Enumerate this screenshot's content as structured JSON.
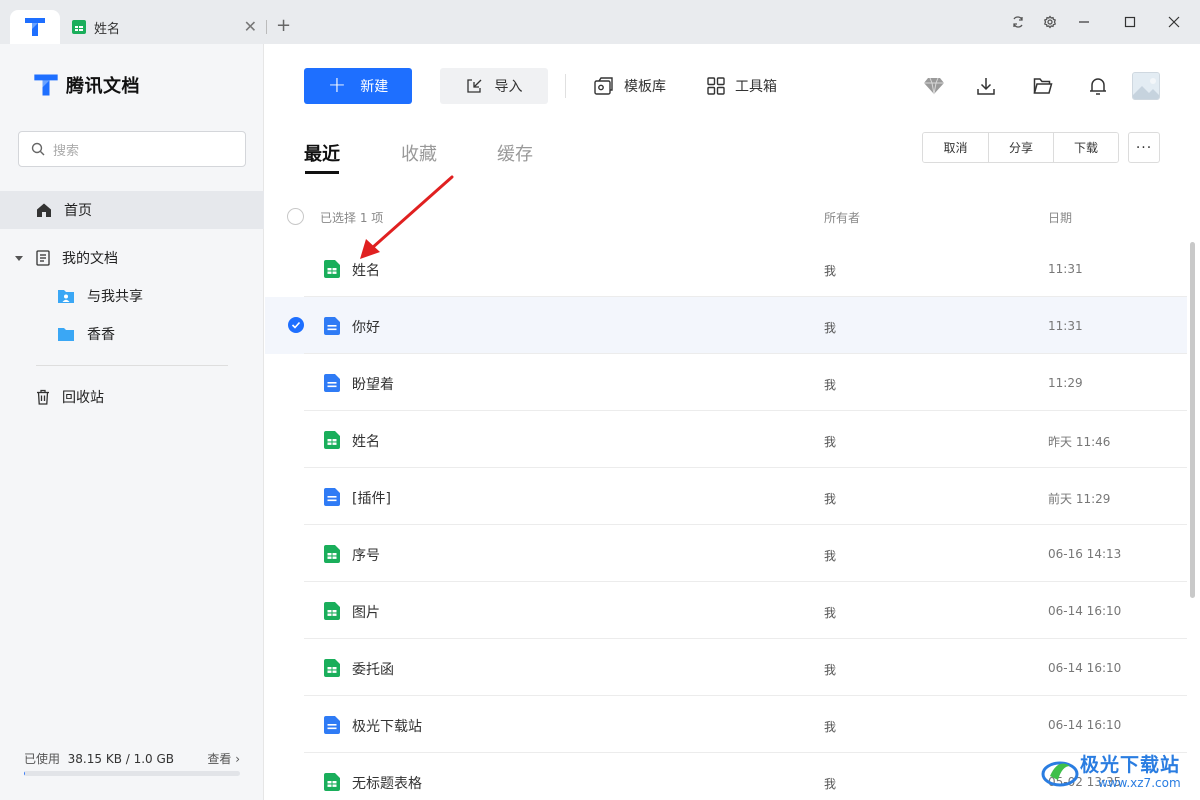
{
  "titlebar": {
    "tab_title": "姓名",
    "close_symbol": "✕",
    "add_symbol": "+"
  },
  "sidebar": {
    "logo_text": "腾讯文档",
    "search_placeholder": "搜索",
    "nav": {
      "home": "首页",
      "my_docs": "我的文档",
      "shared_with_me": "与我共享",
      "folder_xiangxiang": "香香",
      "recycle_bin": "回收站"
    },
    "storage": {
      "label": "已使用",
      "value": "38.15 KB / 1.0 GB",
      "view_link": "查看 ›",
      "used_fraction": 0.0001
    }
  },
  "toolbar": {
    "new_label": "新建",
    "import_label": "导入",
    "templates_label": "模板库",
    "toolbox_label": "工具箱"
  },
  "tabs": {
    "recent": "最近",
    "favorites": "收藏",
    "cache": "缓存"
  },
  "actions": {
    "cancel": "取消",
    "share": "分享",
    "download": "下载",
    "more": "···"
  },
  "list": {
    "header": {
      "selected": "已选择 1 项",
      "owner": "所有者",
      "date": "日期"
    },
    "rows": [
      {
        "name": "姓名",
        "type": "sheet",
        "owner": "我",
        "date": "11:31",
        "selected": false
      },
      {
        "name": "你好",
        "type": "doc",
        "owner": "我",
        "date": "11:31",
        "selected": true
      },
      {
        "name": "盼望着",
        "type": "doc",
        "owner": "我",
        "date": "11:29",
        "selected": false
      },
      {
        "name": "姓名",
        "type": "sheet",
        "owner": "我",
        "date": "昨天 11:46",
        "selected": false
      },
      {
        "name": "[插件]",
        "type": "doc",
        "owner": "我",
        "date": "前天 11:29",
        "selected": false
      },
      {
        "name": "序号",
        "type": "sheet",
        "owner": "我",
        "date": "06-16 14:13",
        "selected": false
      },
      {
        "name": "图片",
        "type": "sheet",
        "owner": "我",
        "date": "06-14 16:10",
        "selected": false
      },
      {
        "name": "委托函",
        "type": "sheet",
        "owner": "我",
        "date": "06-14 16:10",
        "selected": false
      },
      {
        "name": "极光下载站",
        "type": "doc",
        "owner": "我",
        "date": "06-14 16:10",
        "selected": false
      },
      {
        "name": "无标题表格",
        "type": "sheet",
        "owner": "我",
        "date": "05-02 13:35",
        "selected": false
      }
    ]
  },
  "watermark": {
    "title": "极光下载站",
    "url": "www.xz7.com"
  },
  "colors": {
    "accent": "#1e6fff",
    "sheet_icon": "#1aae5b",
    "doc_icon": "#2f7bf5",
    "arrow": "#e02020"
  }
}
